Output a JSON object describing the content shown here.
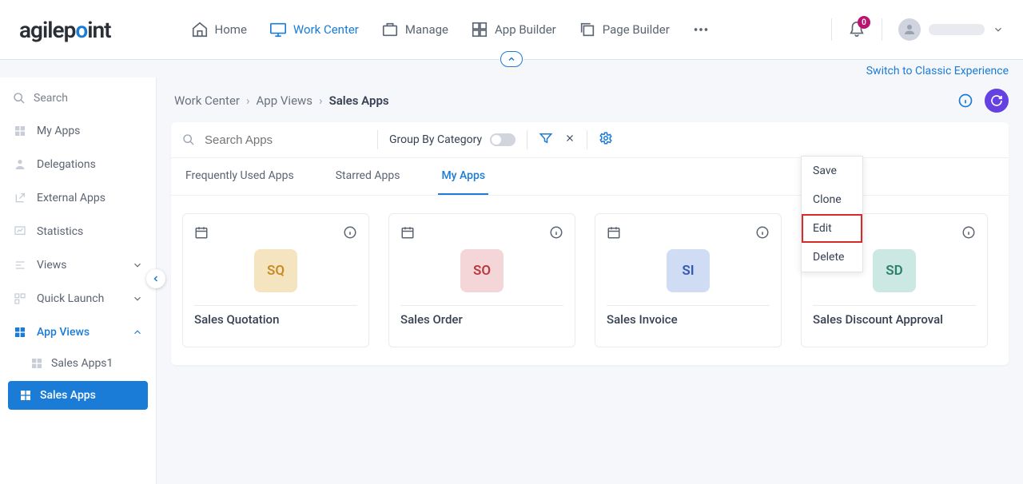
{
  "topnav": {
    "logo": "agilepoint",
    "items": [
      {
        "label": "Home"
      },
      {
        "label": "Work Center"
      },
      {
        "label": "Manage"
      },
      {
        "label": "App Builder"
      },
      {
        "label": "Page Builder"
      }
    ],
    "notif_count": "0"
  },
  "switch_link": "Switch to Classic Experience",
  "sidebar": {
    "search_placeholder": "Search",
    "items": [
      {
        "label": "My Apps"
      },
      {
        "label": "Delegations"
      },
      {
        "label": "External Apps"
      },
      {
        "label": "Statistics"
      }
    ],
    "views_label": "Views",
    "quicklaunch_label": "Quick Launch",
    "appviews_label": "App Views",
    "appviews_children": [
      {
        "label": "Sales Apps1"
      },
      {
        "label": "Sales Apps"
      }
    ]
  },
  "breadcrumb": {
    "a": "Work Center",
    "b": "App Views",
    "c": "Sales Apps"
  },
  "toolbar": {
    "search_placeholder": "Search Apps",
    "groupby_label": "Group By Category"
  },
  "tabs": [
    {
      "label": "Frequently Used Apps"
    },
    {
      "label": "Starred Apps"
    },
    {
      "label": "My Apps"
    }
  ],
  "cards": [
    {
      "abbr": "SQ",
      "title": "Sales Quotation"
    },
    {
      "abbr": "SO",
      "title": "Sales Order"
    },
    {
      "abbr": "SI",
      "title": "Sales Invoice"
    },
    {
      "abbr": "SD",
      "title": "Sales Discount Approval"
    }
  ],
  "dropdown": [
    "Save",
    "Clone",
    "Edit",
    "Delete"
  ]
}
